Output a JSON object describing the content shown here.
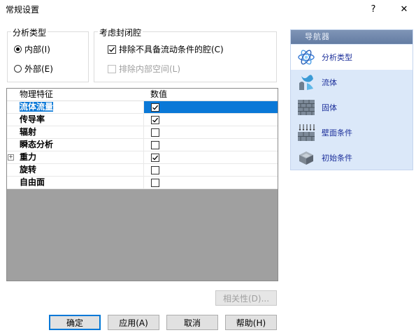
{
  "window": {
    "title": "常规设置",
    "help_glyph": "?",
    "close_glyph": "✕"
  },
  "analysis_type": {
    "title": "分析类型",
    "options": [
      {
        "label": "内部(I)",
        "selected": true
      },
      {
        "label": "外部(E)",
        "selected": false
      }
    ]
  },
  "cavities": {
    "title": "考虑封闭腔",
    "options": [
      {
        "label": "排除不具备流动条件的腔(C)",
        "checked": true,
        "enabled": true
      },
      {
        "label": "排除内部空间(L)",
        "checked": false,
        "enabled": false
      }
    ]
  },
  "table": {
    "columns": [
      "物理特征",
      "数值"
    ],
    "rows": [
      {
        "label": "流体流量",
        "checked": true,
        "selected": true,
        "expandable": false
      },
      {
        "label": "传导率",
        "checked": true,
        "selected": false,
        "expandable": false
      },
      {
        "label": "辐射",
        "checked": false,
        "selected": false,
        "expandable": false
      },
      {
        "label": "瞬态分析",
        "checked": false,
        "selected": false,
        "expandable": false
      },
      {
        "label": "重力",
        "checked": true,
        "selected": false,
        "expandable": true
      },
      {
        "label": "旋转",
        "checked": false,
        "selected": false,
        "expandable": false
      },
      {
        "label": "自由面",
        "checked": false,
        "selected": false,
        "expandable": false
      }
    ]
  },
  "dependency_button": "相关性(D)...",
  "buttons": {
    "ok": "确定",
    "apply": "应用(A)",
    "cancel": "取消",
    "help": "帮助(H)"
  },
  "navigator": {
    "title": "导航器",
    "items": [
      {
        "label": "分析类型",
        "icon": "atom-icon",
        "active": true
      },
      {
        "label": "流体",
        "icon": "fluid-icon",
        "active": false
      },
      {
        "label": "固体",
        "icon": "brick-wall-icon",
        "active": false
      },
      {
        "label": "壁面条件",
        "icon": "wall-conditions-icon",
        "active": false
      },
      {
        "label": "初始条件",
        "icon": "initial-conditions-icon",
        "active": false
      }
    ]
  },
  "colors": {
    "selection": "#0a78d7",
    "nav_bg": "#dbe8f9",
    "nav_header": "#6f86ab",
    "nav_text": "#1b2e9a"
  }
}
